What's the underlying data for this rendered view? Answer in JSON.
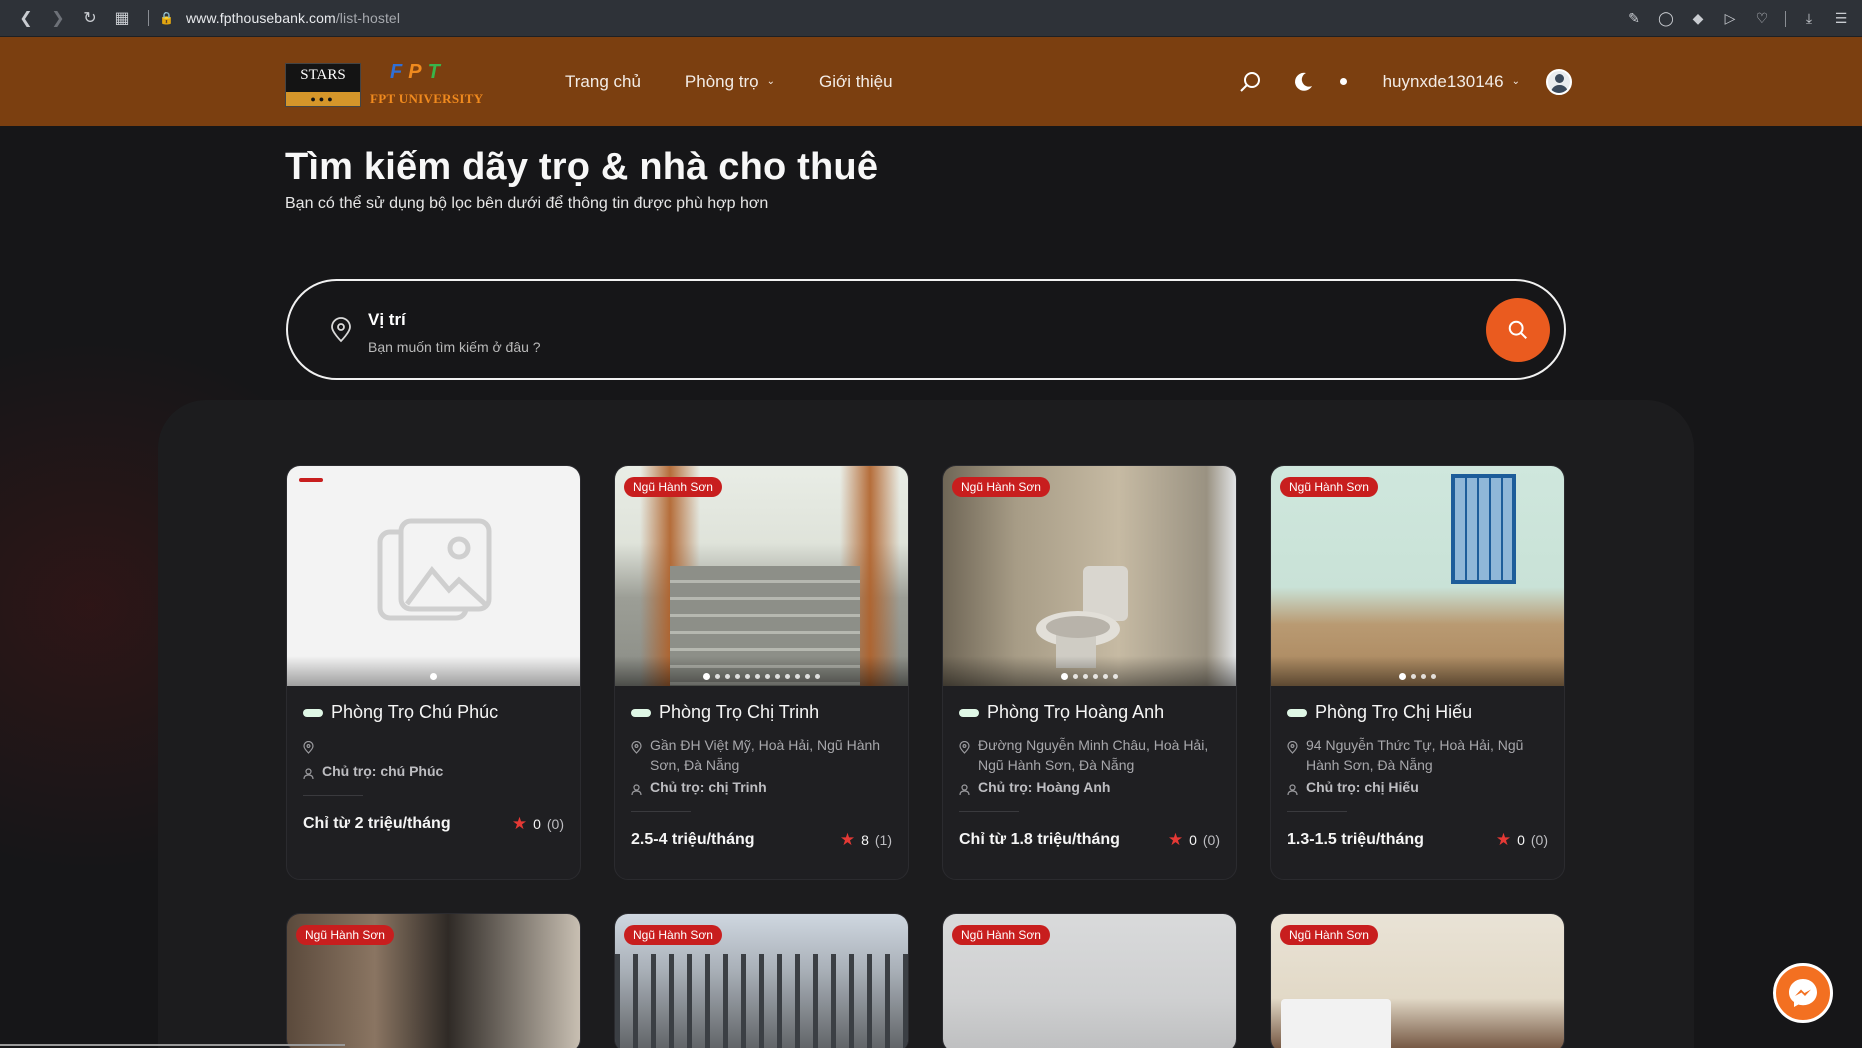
{
  "browser": {
    "url_host": "www.fpthousebank.com",
    "url_path": "/list-hostel"
  },
  "header": {
    "logo_stars_text": "STARS",
    "logo_fpt_text": "FPT",
    "logo_fpt_university": "FPT UNIVERSITY",
    "nav": [
      {
        "label": "Trang chủ"
      },
      {
        "label": "Phòng trọ"
      },
      {
        "label": "Giới thiệu"
      }
    ],
    "username": "huynxde130146"
  },
  "hero": {
    "title": "Tìm kiếm dãy trọ & nhà cho thuê",
    "subtitle": "Bạn có thể sử dụng bộ lọc bên dưới để thông tin được phù hợp hơn"
  },
  "search": {
    "label": "Vị trí",
    "placeholder": "Bạn muốn tìm kiếm ở đâu ?",
    "value": ""
  },
  "listings": [
    {
      "badge": "",
      "name": "Phòng Trọ Chú Phúc",
      "address": "",
      "owner": "Chủ trọ: chú Phúc",
      "price": "Chỉ từ 2 triệu/tháng",
      "rating": "0",
      "rating_count": "(0)",
      "photo_count": 1
    },
    {
      "badge": "Ngũ Hành Sơn",
      "name": "Phòng Trọ Chị Trinh",
      "address": "Gần ĐH Việt Mỹ, Hoà Hải, Ngũ Hành Sơn, Đà Nẵng",
      "owner": "Chủ trọ: chị Trinh",
      "price": "2.5-4 triệu/tháng",
      "rating": "8",
      "rating_count": "(1)",
      "photo_count": 12
    },
    {
      "badge": "Ngũ Hành Sơn",
      "name": "Phòng Trọ Hoàng Anh",
      "address": "Đường Nguyễn Minh Châu, Hoà Hải, Ngũ Hành Sơn, Đà Nẵng",
      "owner": "Chủ trọ: Hoàng Anh",
      "price": "Chỉ từ 1.8 triệu/tháng",
      "rating": "0",
      "rating_count": "(0)",
      "photo_count": 6
    },
    {
      "badge": "Ngũ Hành Sơn",
      "name": "Phòng Trọ Chị Hiếu",
      "address": "94 Nguyễn Thức Tự, Hoà Hải, Ngũ Hành Sơn, Đà Nẵng",
      "owner": "Chủ trọ: chị Hiếu",
      "price": "1.3-1.5 triệu/tháng",
      "rating": "0",
      "rating_count": "(0)",
      "photo_count": 4
    },
    {
      "badge": "Ngũ Hành Sơn"
    },
    {
      "badge": "Ngũ Hành Sơn"
    },
    {
      "badge": "Ngũ Hành Sơn"
    },
    {
      "badge": "Ngũ Hành Sơn"
    }
  ],
  "colors": {
    "header_bg": "#7b3f10",
    "page_bg": "#161618",
    "accent": "#ea5b1f",
    "badge": "#c81e1e",
    "star": "#e53935",
    "messenger": "#f37021"
  }
}
